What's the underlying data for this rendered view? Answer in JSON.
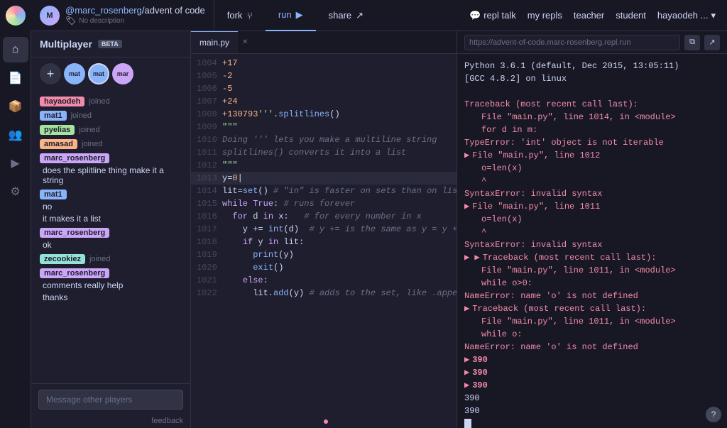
{
  "nav": {
    "logo_alt": "Replit logo",
    "username": "@marc_rosenberg",
    "repo": "/advent of code",
    "desc": "No description",
    "fork_label": "fork",
    "run_label": "run",
    "share_label": "share",
    "repl_talk_label": "repl talk",
    "my_repls_label": "my repls",
    "teacher_label": "teacher",
    "student_label": "student",
    "user_menu_label": "hayaodeh ..."
  },
  "multiplayer": {
    "title": "Multiplayer",
    "beta_label": "BETA",
    "messages": [
      {
        "user": "hayaodeh",
        "color": "#f38ba8",
        "action": "joined",
        "text": ""
      },
      {
        "user": "mat1",
        "color": "#89b4fa",
        "action": "joined",
        "text": ""
      },
      {
        "user": "pyelias",
        "color": "#a6e3a1",
        "action": "joined",
        "text": ""
      },
      {
        "user": "amasad",
        "color": "#fab387",
        "action": "joined",
        "text": ""
      },
      {
        "user": "marc_rosenberg",
        "color": "#cba6f7",
        "action": "",
        "text": "does the splitline thing make it a string"
      },
      {
        "user": "mat1",
        "color": "#89b4fa",
        "action": "",
        "text": "no\nit makes it a list"
      },
      {
        "user": "marc_rosenberg",
        "color": "#cba6f7",
        "action": "",
        "text": "ok"
      },
      {
        "user": "zecookiez",
        "color": "#94e2d5",
        "action": "joined",
        "text": ""
      },
      {
        "user": "marc_rosenberg",
        "color": "#cba6f7",
        "action": "",
        "text": "comments really help\nthanks"
      }
    ],
    "chat_placeholder": "Message other players",
    "feedback_label": "feedback"
  },
  "editor": {
    "filename": "main.py",
    "lines": [
      {
        "num": 1004,
        "content": "+17"
      },
      {
        "num": 1005,
        "content": "-2"
      },
      {
        "num": 1006,
        "content": "-5"
      },
      {
        "num": 1007,
        "content": "+24"
      },
      {
        "num": 1008,
        "content": "+130793'''.splitlines()"
      },
      {
        "num": 1009,
        "content": "\"\"\""
      },
      {
        "num": 1010,
        "content": "Doing ''' lets you make a multiline string"
      },
      {
        "num": 1011,
        "content": "splitlines() converts it into a list"
      },
      {
        "num": 1012,
        "content": "\"\"\""
      },
      {
        "num": 1013,
        "content": "y=0"
      },
      {
        "num": 1014,
        "content": "lit=set() # \"in\" is faster on sets than on lists"
      },
      {
        "num": 1015,
        "content": "while True: # runs forever"
      },
      {
        "num": 1016,
        "content": "  for d in x:   # for every number in x"
      },
      {
        "num": 1017,
        "content": "    y += int(d)  # y += is the same as y = y +"
      },
      {
        "num": 1018,
        "content": "    if y in lit:"
      },
      {
        "num": 1019,
        "content": "      print(y)"
      },
      {
        "num": 1020,
        "content": "      exit()"
      },
      {
        "num": 1021,
        "content": "    else:"
      },
      {
        "num": 1022,
        "content": "      lit.add(y) # adds to the set, like .append()"
      }
    ]
  },
  "console": {
    "url": "https://advent-of-code.marc-rosenberg.repl.run",
    "output": [
      {
        "type": "normal",
        "text": "Python 3.6.1 (default, Dec 2015, 13:05:11)"
      },
      {
        "type": "normal",
        "text": "[GCC 4.8.2] on linux"
      },
      {
        "type": "error",
        "prefix": "",
        "text": "Traceback (most recent call last):"
      },
      {
        "type": "error-indent",
        "text": "File \"main.py\", line 1014, in <module>"
      },
      {
        "type": "error-indent",
        "text": "  for d in m:"
      },
      {
        "type": "error",
        "text": "TypeError: 'int' object is not iterable"
      },
      {
        "type": "arrow",
        "text": "File \"main.py\", line 1012"
      },
      {
        "type": "indent",
        "text": "o=len(x)"
      },
      {
        "type": "indent",
        "text": "^"
      },
      {
        "type": "error",
        "text": "SyntaxError: invalid syntax"
      },
      {
        "type": "arrow",
        "text": "File \"main.py\", line 1011"
      },
      {
        "type": "indent",
        "text": "o=len(x)"
      },
      {
        "type": "indent",
        "text": "^"
      },
      {
        "type": "error",
        "text": "SyntaxError: invalid syntax"
      },
      {
        "type": "arrow2",
        "text": "Traceback (most recent call last):"
      },
      {
        "type": "indent",
        "text": "File \"main.py\", line 1011, in <module>"
      },
      {
        "type": "indent",
        "text": "  while o>0:"
      },
      {
        "type": "error",
        "text": "NameError: name 'o' is not defined"
      },
      {
        "type": "arrow2",
        "text": "Traceback (most recent call last):"
      },
      {
        "type": "indent",
        "text": "File \"main.py\", line 1011, in <module>"
      },
      {
        "type": "indent",
        "text": "  while o:"
      },
      {
        "type": "error",
        "text": "NameError: name 'o' is not defined"
      },
      {
        "type": "number",
        "text": "390"
      },
      {
        "type": "number",
        "text": "390"
      },
      {
        "type": "number",
        "text": "390"
      },
      {
        "type": "plain",
        "text": "390"
      },
      {
        "type": "plain",
        "text": "390"
      },
      {
        "type": "cursor",
        "text": ""
      }
    ]
  },
  "icons": {
    "home": "⌂",
    "files": "📄",
    "packages": "📦",
    "users": "👥",
    "play": "▶",
    "settings": "⚙",
    "add": "+",
    "fork_icon": "⑂",
    "run_icon": "▶",
    "share_icon": "↗",
    "external_link": "↗",
    "copy_icon": "⧉",
    "help": "?",
    "repltalk_icon": "💬"
  }
}
